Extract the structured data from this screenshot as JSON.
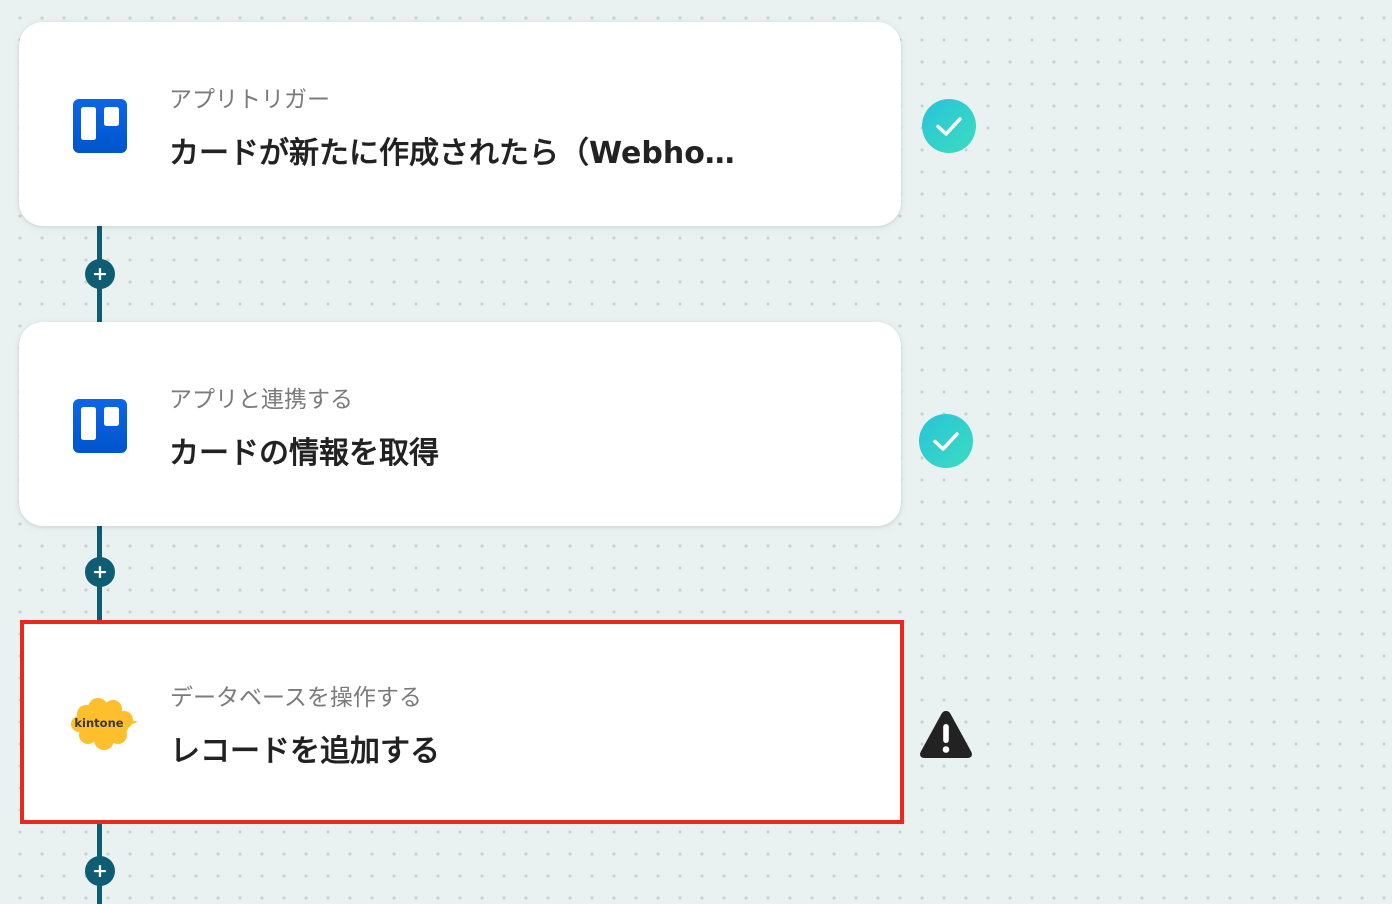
{
  "flow": {
    "steps": [
      {
        "subtitle": "アプリトリガー",
        "title": "カードが新たに作成されたら（Webho…",
        "app_icon": "trello-icon",
        "status": "success"
      },
      {
        "subtitle": "アプリと連携する",
        "title": "カードの情報を取得",
        "app_icon": "trello-icon",
        "status": "success"
      },
      {
        "subtitle": "データベースを操作する",
        "title": "レコードを追加する",
        "app_icon": "kintone-logo",
        "app_logo_text": "kintone",
        "status": "warning",
        "selected": true
      }
    ],
    "add_button_icon": "plus-icon"
  },
  "colors": {
    "connector": "#0f5d73",
    "success_gradient_start": "#2bc7d6",
    "success_gradient_end": "#3ad9c0",
    "warning": "#222222",
    "selected_border": "#e8291c",
    "trello_blue": "#0a63d8",
    "kintone_yellow": "#fdbf2c"
  }
}
